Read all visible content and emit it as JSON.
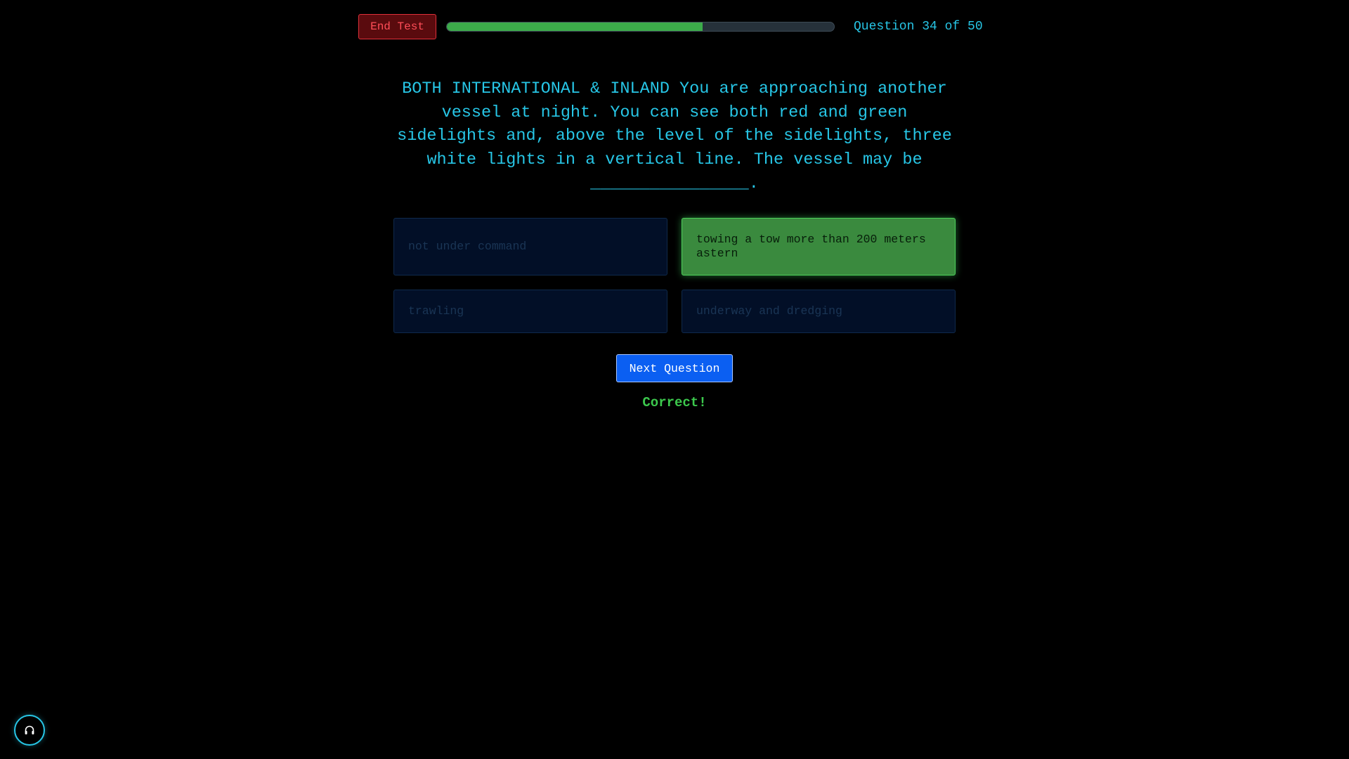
{
  "header": {
    "end_test_label": "End Test",
    "progress_fraction": 0.66,
    "progress_counter": "Question 34 of 50"
  },
  "question": {
    "text": "BOTH INTERNATIONAL & INLAND You are approaching another vessel at night. You can see both red and green sidelights and, above the level of the sidelights, three white lights in a vertical line. The vessel may be ________________."
  },
  "answers": [
    {
      "label": "not under command",
      "state": "disabled"
    },
    {
      "label": "towing a tow more than 200 meters astern",
      "state": "correct"
    },
    {
      "label": "trawling",
      "state": "disabled"
    },
    {
      "label": "underway and dredging",
      "state": "disabled"
    }
  ],
  "next_button_label": "Next Question",
  "feedback_text": "Correct!",
  "audio_icon": "headphones-icon",
  "colors": {
    "background": "#000000",
    "accent_cyan": "#27c6e6",
    "correct_green": "#3a8a3e",
    "progress_green": "#3cab4a",
    "next_blue": "#0b5ff2",
    "end_test_red": "#ff4d57"
  }
}
